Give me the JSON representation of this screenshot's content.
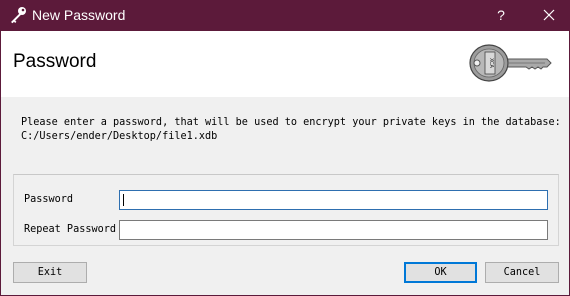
{
  "window": {
    "title": "New Password",
    "help_label": "?",
    "close_icon": "close-icon",
    "app_icon": "key-icon"
  },
  "header": {
    "title": "Password",
    "logo": "key-logo"
  },
  "info": {
    "line1": "Please enter a password, that will be used to encrypt your private keys in the database:",
    "line2": "C:/Users/ender/Desktop/file1.xdb"
  },
  "form": {
    "password_label": "Password",
    "password_value": "",
    "repeat_label": "Repeat Password",
    "repeat_value": ""
  },
  "buttons": {
    "exit_label": "Exit",
    "ok_label": "OK",
    "cancel_label": "Cancel"
  },
  "colors": {
    "titlebar": "#5c1a3a",
    "focus": "#0078d7"
  }
}
